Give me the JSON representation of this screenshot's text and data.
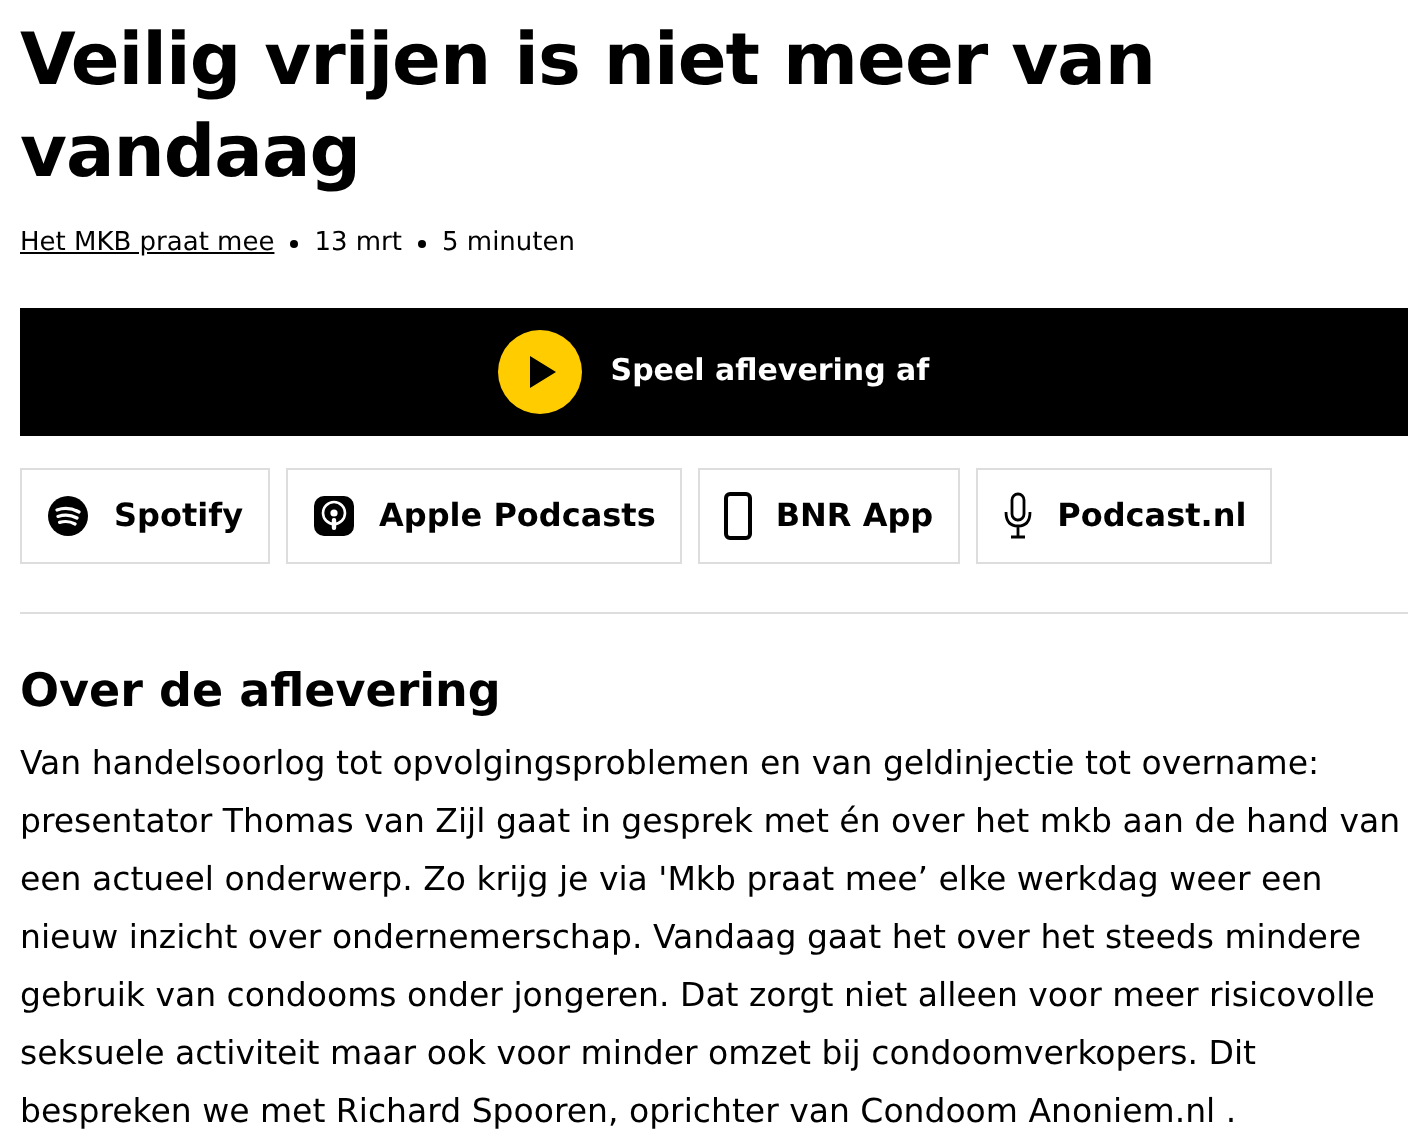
{
  "title": "Veilig vrijen is niet meer van vandaag",
  "meta": {
    "program": "Het MKB praat mee",
    "date": "13 mrt",
    "duration": "5 minuten"
  },
  "player": {
    "label": "Speel aflevering af"
  },
  "platforms": [
    {
      "kind": "spotify",
      "label": "Spotify"
    },
    {
      "kind": "apple",
      "label": "Apple Podcasts"
    },
    {
      "kind": "app",
      "label": "BNR App"
    },
    {
      "kind": "mic",
      "label": "Podcast.nl"
    }
  ],
  "about": {
    "heading": "Over de aflevering",
    "text": "Van handelsoorlog tot opvolgingsproblemen en van geldinjectie tot overname: presentator Thomas van Zijl gaat in gesprek met én over het mkb aan de hand van een actueel onderwerp. Zo krijg je via 'Mkb praat mee’ elke werkdag weer een nieuw inzicht over ondernemerschap. Vandaag gaat het over het steeds mindere gebruik van condooms onder jongeren. Dat zorgt niet alleen voor meer risicovolle seksuele activiteit maar ook voor minder omzet bij condoomverkopers. Dit bespreken we met Richard Spooren, oprichter van Condoom Anoniem.nl ."
  }
}
